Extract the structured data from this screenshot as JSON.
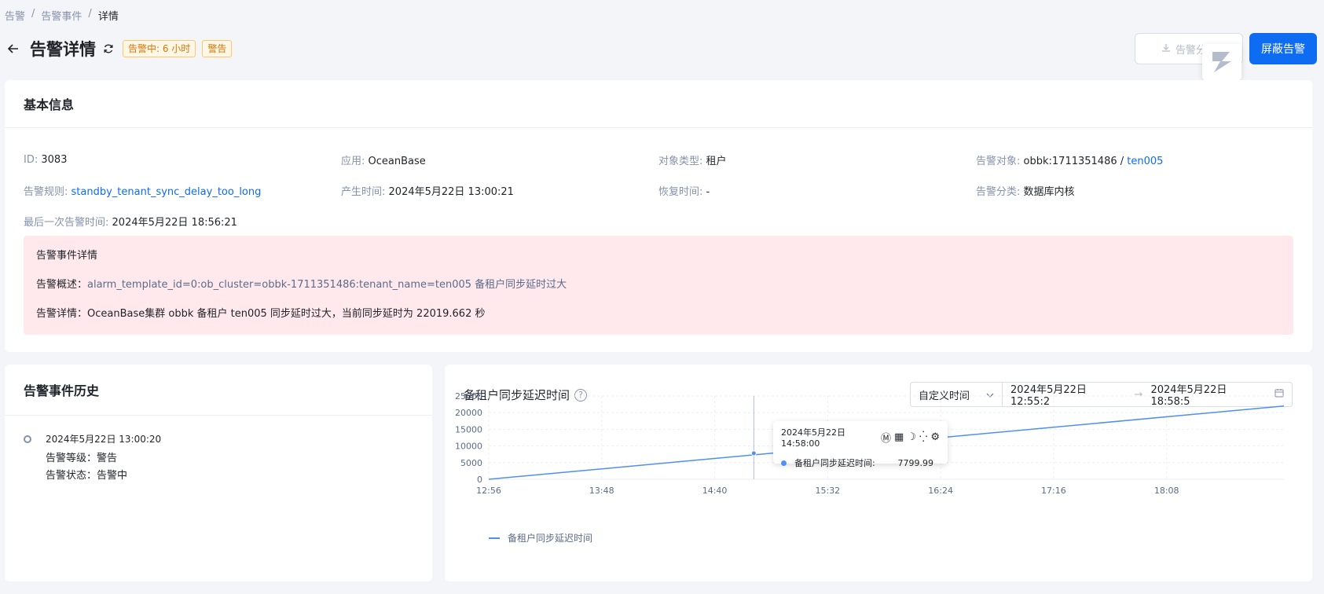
{
  "breadcrumb": [
    "告警",
    "详情"
  ],
  "breadcrumb_middle": "告警事件",
  "header": {
    "title": "告警详情",
    "status_tag": "告警中: 6 小时",
    "level_tag": "警告",
    "analysis_label": "告警分析",
    "shield_label": "屏蔽告警"
  },
  "base_info": {
    "title": "基本信息",
    "rows": [
      [
        {
          "label": "ID:",
          "value": "3083"
        },
        {
          "label": "应用:",
          "value": "OceanBase"
        },
        {
          "label": "对象类型:",
          "value": "租户"
        },
        {
          "label": "告警对象:",
          "value": "obbk:1711351486 / ",
          "link": "ten005"
        }
      ],
      [
        {
          "label": "告警规则:",
          "link": "standby_tenant_sync_delay_too_long"
        },
        {
          "label": "产生时间:",
          "value": "2024年5月22日 13:00:21"
        },
        {
          "label": "恢复时间:",
          "value": "-"
        },
        {
          "label": "告警分类:",
          "value": "数据库内核"
        }
      ],
      [
        {
          "label": "最后一次告警时间:",
          "value": "2024年5月22日 18:56:21"
        }
      ]
    ],
    "event_detail": {
      "title": "告警事件详情",
      "summary_label": "告警概述：",
      "summary_value": "alarm_template_id=0:ob_cluster=obbk-1711351486:tenant_name=ten005 备租户同步延时过大",
      "detail_label": "告警详情：",
      "detail_value": "OceanBase集群 obbk 备租户 ten005 同步延时过大，当前同步延时为 22019.662 秒"
    }
  },
  "history": {
    "title": "告警事件历史",
    "items": [
      {
        "time": "2024年5月22日 13:00:20",
        "level": "告警等级：警告",
        "status": "告警状态：告警中"
      }
    ]
  },
  "chart_panel": {
    "title": "备租户同步延迟时间",
    "help": "?",
    "time_select": "自定义时间",
    "range_start": "2024年5月22日 12:55:2",
    "range_end": "2024年5月22日 18:58:5",
    "tooltip": {
      "time": "2024年5月22日 14:58:00",
      "series": "备租户同步延迟时间:",
      "value": "7799.99"
    }
  },
  "chart_data": {
    "type": "line",
    "x": [
      "12:56",
      "19:02"
    ],
    "series": [
      {
        "name": "备租户同步延迟时间",
        "values": [
          0,
          22000
        ],
        "color": "#4f8ff2"
      }
    ],
    "highlight": {
      "x": "14:58",
      "y": 7799.99
    },
    "x_ticks": [
      "12:56",
      "13:48",
      "14:40",
      "15:32",
      "16:24",
      "17:16",
      "18:08"
    ],
    "y_ticks": [
      0,
      5000,
      10000,
      15000,
      20000,
      25000
    ],
    "ylim": [
      0,
      25000
    ],
    "xlim_minutes": [
      0,
      366
    ],
    "grid": true,
    "legend": "bottom-left"
  }
}
